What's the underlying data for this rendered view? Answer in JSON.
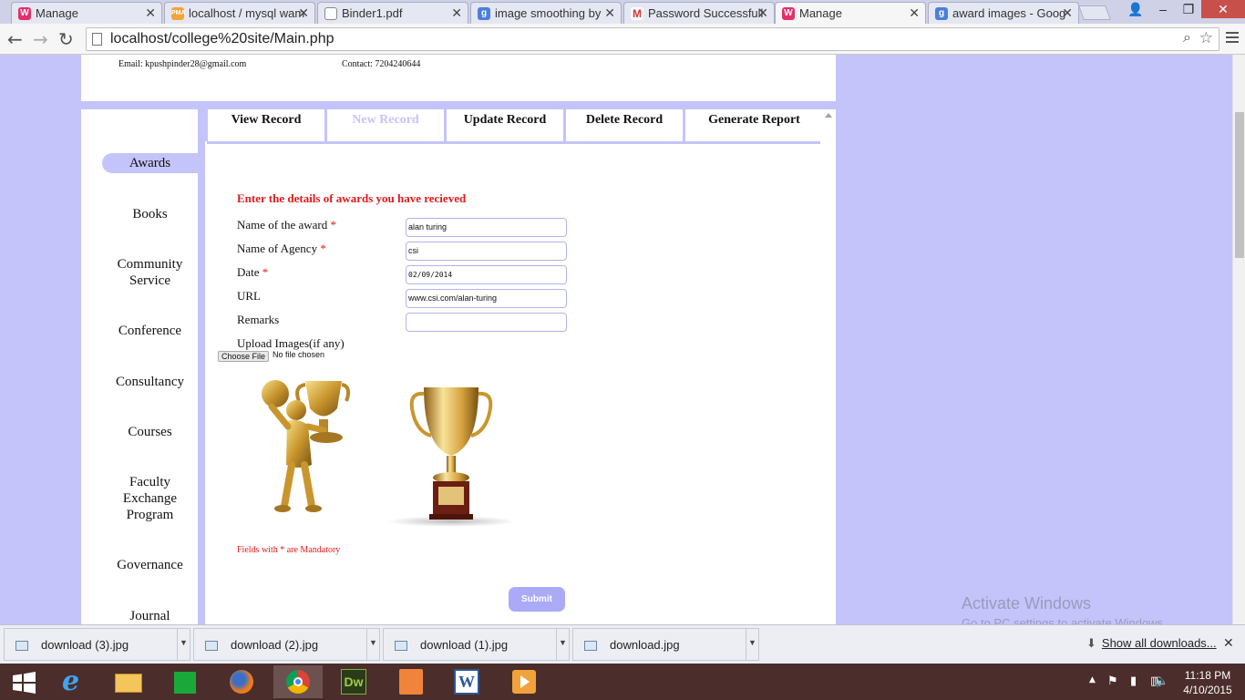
{
  "browser": {
    "tabs": [
      {
        "title": "Manage",
        "icon": "wamp-icon",
        "active": false
      },
      {
        "title": "localhost / mysql wam",
        "icon": "phpmyadmin-icon",
        "active": false
      },
      {
        "title": "Binder1.pdf",
        "icon": "document-icon",
        "active": false
      },
      {
        "title": "image smoothing by",
        "icon": "google-icon",
        "active": false
      },
      {
        "title": "Password Successfull",
        "icon": "gmail-icon",
        "active": false
      },
      {
        "title": "Manage",
        "icon": "wamp-icon",
        "active": true
      },
      {
        "title": "award images - Goog",
        "icon": "google-icon",
        "active": false
      }
    ],
    "url": "localhost/college%20site/Main.php"
  },
  "header": {
    "email": "Email: kpushpinder28@gmail.com",
    "contact": "Contact: 7204240644"
  },
  "sidebar": {
    "items": [
      {
        "label": "Awards",
        "active": true
      },
      {
        "label": "Books"
      },
      {
        "label": "Community Service"
      },
      {
        "label": "Conference"
      },
      {
        "label": "Consultancy"
      },
      {
        "label": "Courses"
      },
      {
        "label": "Faculty Exchange Program"
      },
      {
        "label": "Governance"
      },
      {
        "label": "Journal"
      }
    ]
  },
  "topnav": {
    "items": [
      {
        "label": "View Record"
      },
      {
        "label": "New Record",
        "disabled": true
      },
      {
        "label": "Update Record"
      },
      {
        "label": "Delete Record"
      },
      {
        "label": "Generate Report"
      }
    ]
  },
  "form": {
    "title": "Enter the details of awards you have recieved",
    "required_mark": "*",
    "fields": {
      "award_name": {
        "label": "Name of the award",
        "value": "alan turing"
      },
      "agency": {
        "label": "Name of Agency",
        "value": "csi"
      },
      "date": {
        "label": "Date",
        "value": "02/09/2014"
      },
      "url": {
        "label": "URL",
        "value": "www.csi.com/alan-turing"
      },
      "remarks": {
        "label": "Remarks",
        "value": ""
      }
    },
    "upload_label": "Upload Images(if any)",
    "choose_file": "Choose File",
    "no_file": "No file chosen",
    "mandatory_note": "Fields with * are Mandatory",
    "submit": "Submit"
  },
  "watermark": {
    "line1": "Activate Windows",
    "line2": "Go to PC settings to activate Windows."
  },
  "downloads": {
    "items": [
      "download (3).jpg",
      "download (2).jpg",
      "download (1).jpg",
      "download.jpg"
    ],
    "show_all": "Show all downloads..."
  },
  "taskbar": {
    "apps": [
      "windows-start",
      "internet-explorer",
      "file-explorer",
      "store",
      "firefox",
      "chrome",
      "dreamweaver",
      "sublime",
      "word",
      "media-player"
    ],
    "time": "11:18 PM",
    "date": "4/10/2015"
  },
  "colors": {
    "accent": "#c4c4fa",
    "required": "#e11a1a",
    "submit": "#aaaaf8"
  }
}
